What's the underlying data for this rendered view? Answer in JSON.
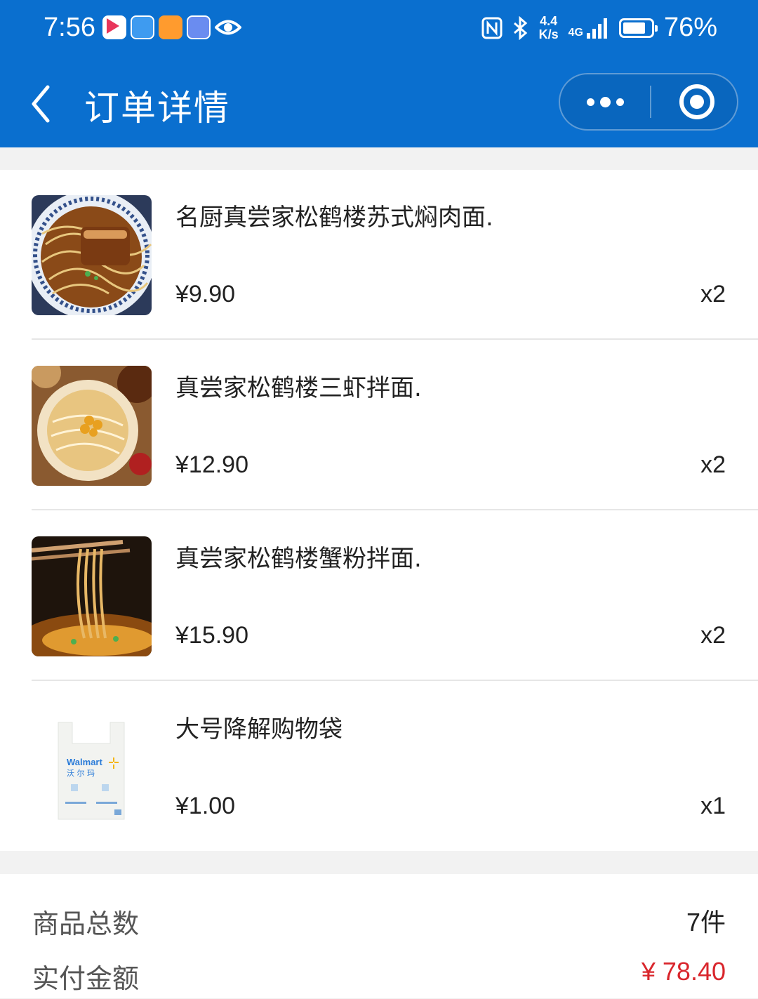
{
  "status_bar": {
    "time": "7:56",
    "net_speed_top": "4.4",
    "net_speed_bottom": "K/s",
    "network": "4G",
    "battery": "76%",
    "icons": [
      "video-app-icon",
      "browser-app-icon",
      "orange-app-icon",
      "music-app-icon",
      "eye-icon",
      "nfc-icon",
      "bluetooth-icon",
      "signal-icon",
      "battery-icon"
    ]
  },
  "header": {
    "title": "订单详情",
    "back_icon": "chevron-left-icon",
    "more_icon": "more-dots-icon",
    "close_icon": "target-close-icon"
  },
  "items": [
    {
      "name": "名厨真尝家松鹤楼苏式焖肉面.",
      "price": "¥9.90",
      "qty": "x2",
      "thumb": "braised-pork-noodle-photo"
    },
    {
      "name": "真尝家松鹤楼三虾拌面.",
      "price": "¥12.90",
      "qty": "x2",
      "thumb": "shrimp-noodle-photo"
    },
    {
      "name": "真尝家松鹤楼蟹粉拌面.",
      "price": "¥15.90",
      "qty": "x2",
      "thumb": "crab-noodle-photo"
    },
    {
      "name": "大号降解购物袋",
      "price": "¥1.00",
      "qty": "x1",
      "thumb": "shopping-bag-photo",
      "bag_brand": "Walmart",
      "bag_brand_cn": "沃 尔 玛"
    }
  ],
  "summary": {
    "total_items_label": "商品总数",
    "total_items_value": "7件",
    "paid_label": "实付金额",
    "paid_value": "¥ 78.40"
  },
  "colors": {
    "header_bg": "#0a6fcf",
    "price_red": "#d9262c",
    "page_bg": "#f2f2f2"
  }
}
